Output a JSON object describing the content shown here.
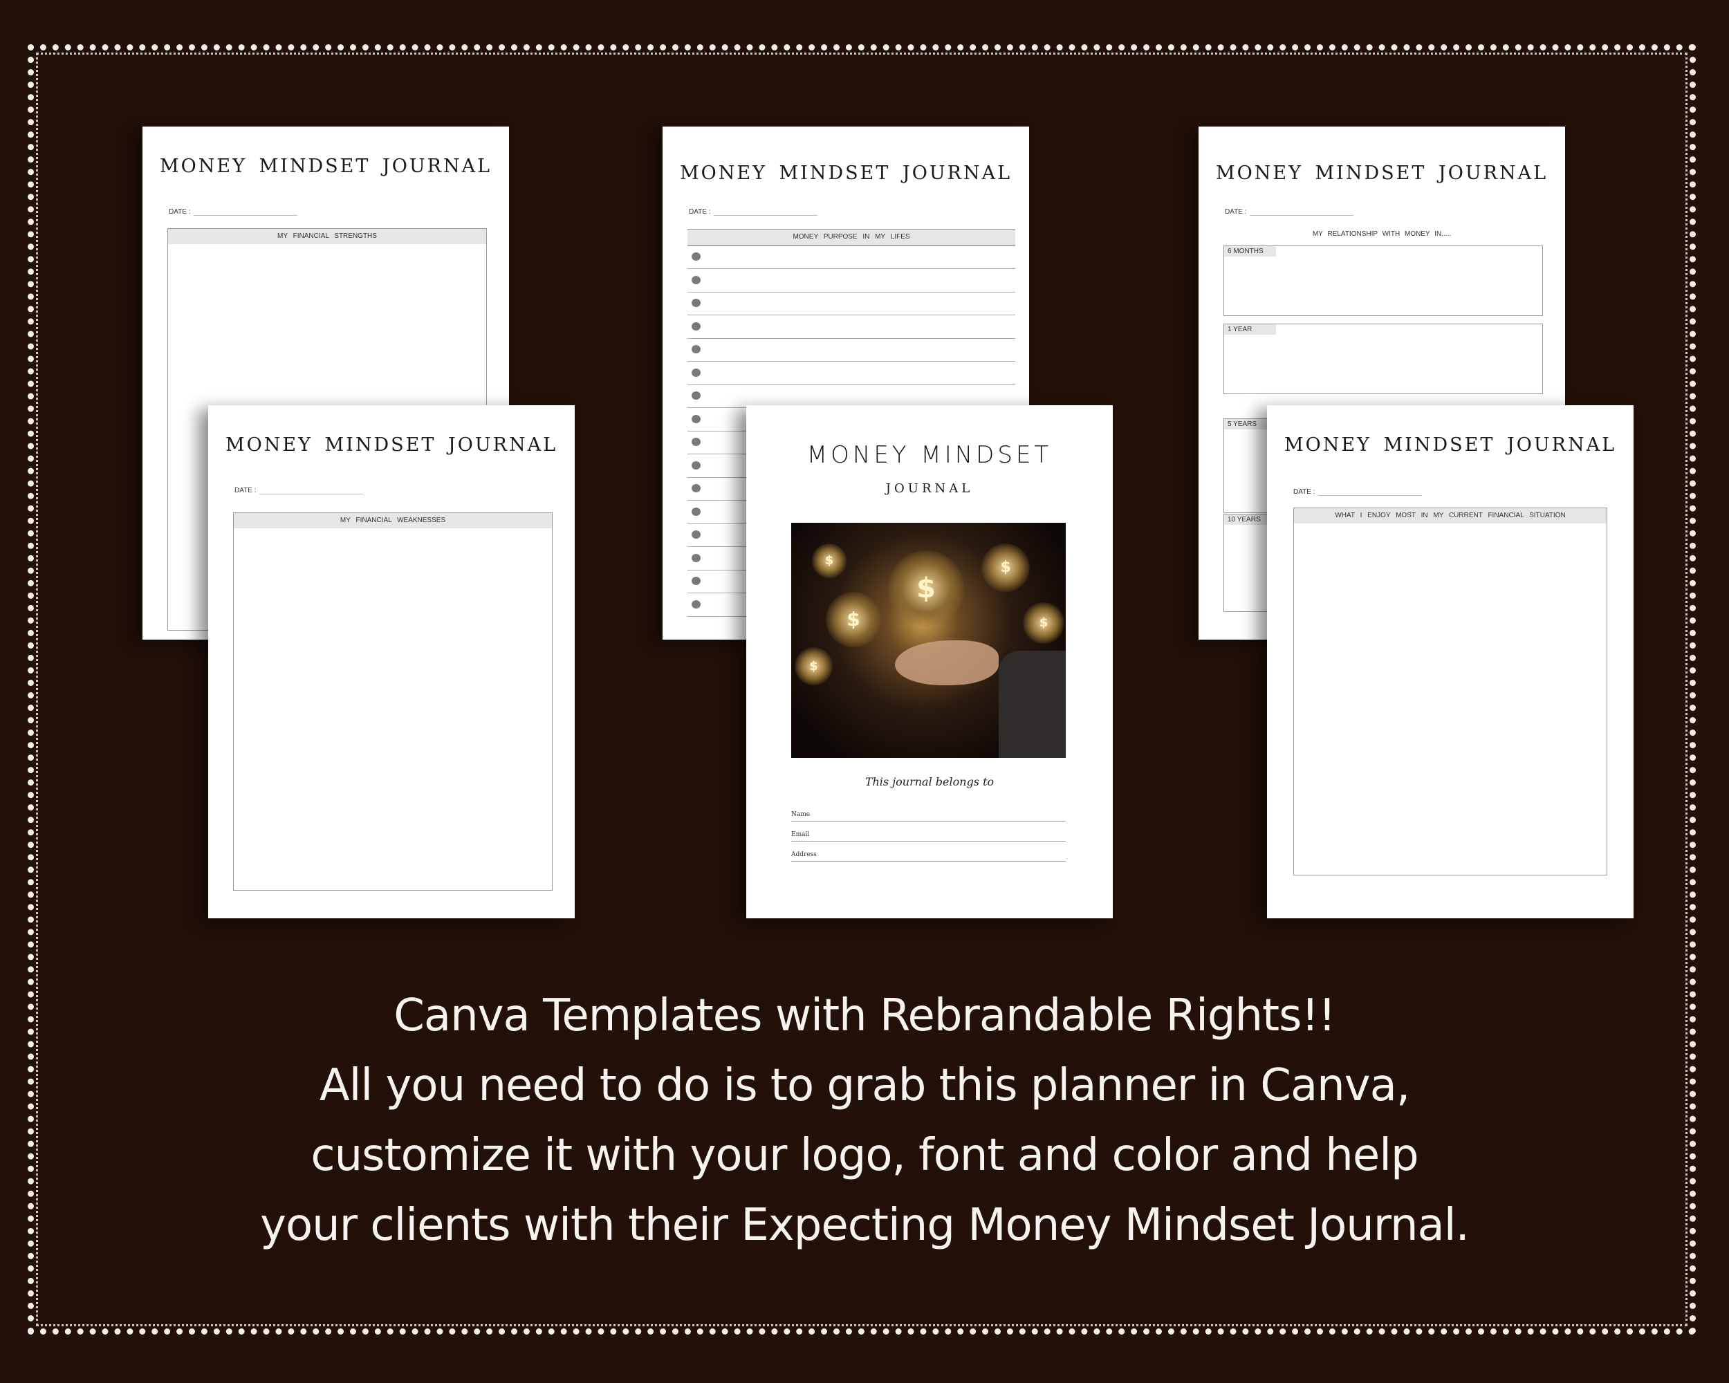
{
  "colors": {
    "background": "#231009",
    "page": "#ffffff",
    "header_band": "#e7e6e4",
    "bullet": "#7a7a72"
  },
  "journal_title": "MONEY MINDSET JOURNAL",
  "date_label": "DATE :",
  "pages": {
    "strengths": {
      "section": "MY  FINANCIAL  STRENGTHS"
    },
    "purpose": {
      "section": "MONEY  PURPOSE  IN  MY  LIFES",
      "bullet_count": 16
    },
    "relationship": {
      "subtitle": "MY  RELATIONSHIP  WITH  MONEY  IN.....",
      "periods": [
        "6  MONTHS",
        "1  YEAR",
        "5  YEARS",
        "10  YEARS"
      ]
    },
    "weaknesses": {
      "section": "MY  FINANCIAL   WEAKNESSES"
    },
    "cover": {
      "title": "MONEY MINDSET",
      "subtitle": "JOURNAL",
      "image": "hand-with-dollar-network-image",
      "belongs": "This journal belongs to",
      "fields": [
        "Name",
        "Email",
        "Address"
      ]
    },
    "enjoy": {
      "section": "WHAT  I ENJOY  MOST IN MY CURRENT  FINANCIAL SITUATION"
    }
  },
  "caption": [
    "Canva Templates with Rebrandable Rights!!",
    "All you need to do is to grab this planner in Canva,",
    "customize it with your logo, font and color and help",
    "your clients with their Expecting Money Mindset Journal."
  ]
}
